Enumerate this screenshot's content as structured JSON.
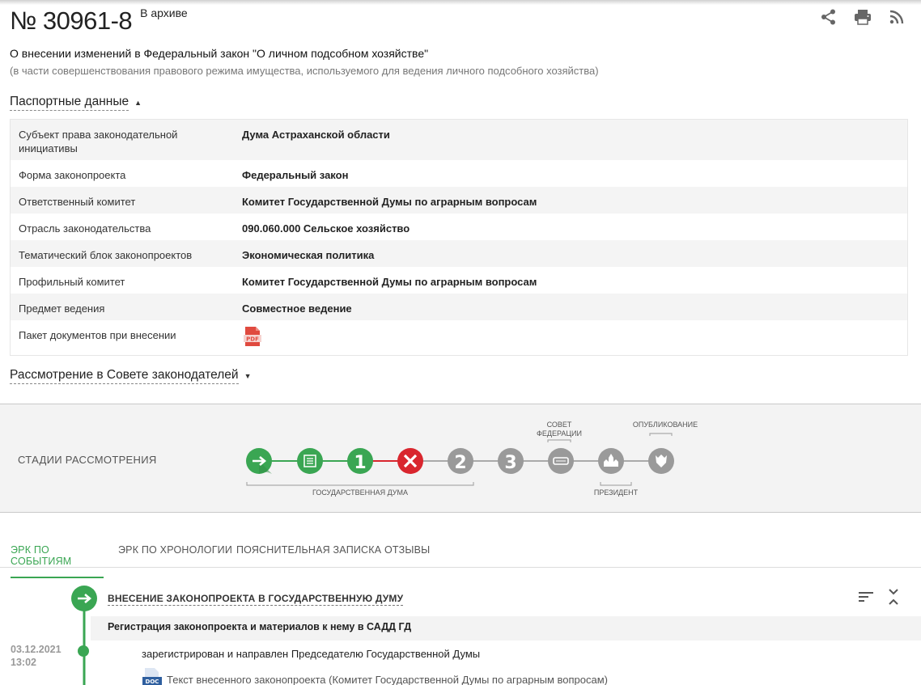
{
  "header": {
    "number": "№ 30961-8",
    "status": "В архиве"
  },
  "icons": {
    "share": "share-icon",
    "print": "print-icon",
    "rss": "rss-icon"
  },
  "bill": {
    "title": "О внесении изменений в Федеральный закон \"О личном подсобном хозяйстве\"",
    "subtitle": "(в части совершенствования правового режима имущества, используемого для ведения личного подсобного хозяйства)"
  },
  "passport": {
    "toggle_label": "Паспортные данные",
    "rows": [
      {
        "label": "Субъект права законодательной инициативы",
        "value": "Дума Астраханской области"
      },
      {
        "label": "Форма законопроекта",
        "value": "Федеральный закон"
      },
      {
        "label": "Ответственный комитет",
        "value": "Комитет Государственной Думы по аграрным вопросам"
      },
      {
        "label": "Отрасль законодательства",
        "value": "090.060.000 Сельское хозяйство"
      },
      {
        "label": "Тематический блок законопроектов",
        "value": "Экономическая политика"
      },
      {
        "label": "Профильный комитет",
        "value": "Комитет Государственной Думы по аграрным вопросам"
      },
      {
        "label": "Предмет ведения",
        "value": "Совместное ведение"
      },
      {
        "label": "Пакет документов при внесении",
        "value": ""
      }
    ],
    "pdf_label": "PDF"
  },
  "council": {
    "toggle_label": "Рассмотрение в Совете законодателей"
  },
  "stages": {
    "label": "СТАДИИ РАССМОТРЕНИЯ",
    "duma_label": "ГОСУДАРСТВЕННАЯ ДУМА",
    "federation_label_1": "СОВЕТ",
    "federation_label_2": "ФЕДЕРАЦИИ",
    "president_label": "ПРЕЗИДЕНТ",
    "published_label": "ОПУБЛИКОВАНИЕ",
    "first_reading": "1",
    "second_reading": "2",
    "third_reading": "3",
    "colors": {
      "done": "#3aa653",
      "rejected": "#d9262e",
      "pending": "#9a9a9a"
    }
  },
  "tabs": [
    {
      "label": "ЭРК ПО СОБЫТИЯМ"
    },
    {
      "label": "ЭРК ПО ХРОНОЛОГИИ"
    },
    {
      "label": "ПОЯСНИТЕЛЬНАЯ ЗАПИСКА"
    },
    {
      "label": "ОТЗЫВЫ"
    }
  ],
  "timeline": {
    "event_title": "ВНЕСЕНИЕ ЗАКОНОПРОЕКТА В ГОСУДАРСТВЕННУЮ ДУМУ",
    "sub_event": "Регистрация законопроекта и материалов к нему в САДД ГД",
    "date": "03.12.2021",
    "time": "13:02",
    "description": "зарегистрирован и направлен Председателю Государственной Думы",
    "doc_label": "DOC",
    "doc_text": "Текст внесенного законопроекта (Комитет Государственной Думы по аграрным вопросам)"
  }
}
